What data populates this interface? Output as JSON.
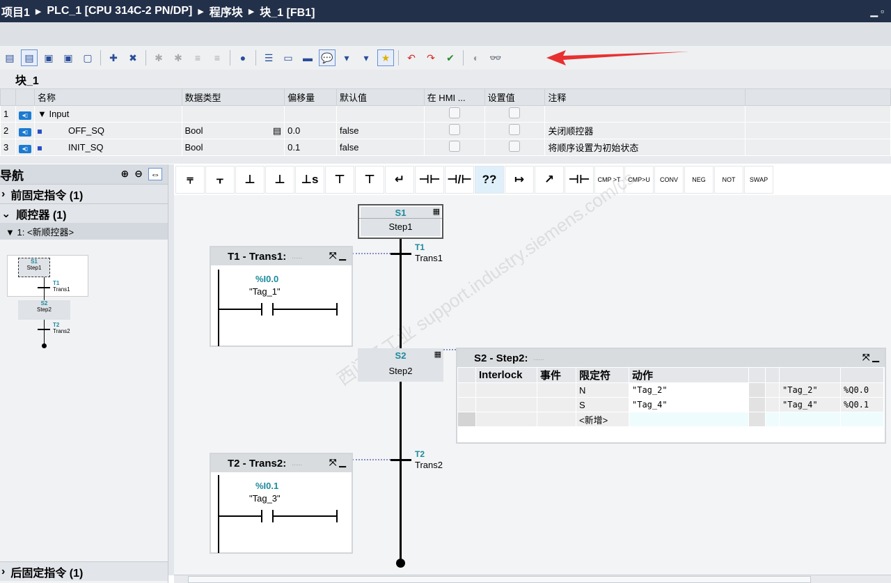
{
  "breadcrumb": [
    "项目1",
    "PLC_1 [CPU 314C-2 PN/DP]",
    "程序块",
    "块_1 [FB1]"
  ],
  "block_title": "块_1",
  "interface": {
    "columns": [
      "",
      "",
      "名称",
      "数据类型",
      "偏移量",
      "默认值",
      "在 HMI ...",
      "设置值",
      "注释"
    ],
    "rows": [
      {
        "num": "1",
        "name": "Input",
        "type": "",
        "offset": "",
        "default": "",
        "comment": ""
      },
      {
        "num": "2",
        "name": "OFF_SQ",
        "type": "Bool",
        "offset": "0.0",
        "default": "false",
        "comment": "关闭顺控器"
      },
      {
        "num": "3",
        "name": "INIT_SQ",
        "type": "Bool",
        "offset": "0.1",
        "default": "false",
        "comment": "将顺序设置为初始状态"
      }
    ]
  },
  "nav": {
    "title": "导航",
    "sections": [
      "前固定指令 (1)",
      "顺控器 (1)",
      "后固定指令 (1)"
    ],
    "sub_item": "1: <新顺控器>",
    "mini": {
      "s1": "S1",
      "step1": "Step1",
      "t1": "T1",
      "trans1": "Trans1",
      "s2": "S2",
      "step2": "Step2",
      "t2": "T2",
      "trans2": "Trans2"
    }
  },
  "palette": [
    "⫧",
    "⫟",
    "⊥",
    "⊥",
    "⊥s",
    "⊤",
    "⊤",
    "↵",
    "⊣⊢",
    "⊣/⊢",
    "??",
    "↦",
    "↗",
    "⊣⊢",
    "CMP >T",
    "CMP>U",
    "CONV",
    "NEG",
    "NOT",
    "SWAP"
  ],
  "graph": {
    "s1": {
      "name": "S1",
      "label": "Step1"
    },
    "s2": {
      "name": "S2",
      "label": "Step2"
    },
    "t1": {
      "name": "T1",
      "label": "Trans1",
      "panel_title": "T1 - Trans1:",
      "address": "%I0.0",
      "tag": "\"Tag_1\""
    },
    "t2": {
      "name": "T2",
      "label": "Trans2",
      "panel_title": "T2 - Trans2:",
      "address": "%I0.1",
      "tag": "\"Tag_3\""
    },
    "step_panel": {
      "title": "S2 - Step2:",
      "columns": [
        "Interlock",
        "事件",
        "限定符",
        "动作"
      ],
      "rows": [
        {
          "qual": "N",
          "action": "\"Tag_2\"",
          "tag": "\"Tag_2\"",
          "addr": "%Q0.0"
        },
        {
          "qual": "S",
          "action": "\"Tag_4\"",
          "tag": "\"Tag_4\"",
          "addr": "%Q0.1"
        },
        {
          "qual": "<新增>",
          "action": "",
          "tag": "",
          "addr": ""
        }
      ]
    }
  },
  "watermark": "西门子工业 support.industry.siemens.com/cs",
  "colors": {
    "title_bg": "#23304a",
    "step_name": "#1a8a9c",
    "arrow": "#e83030"
  }
}
